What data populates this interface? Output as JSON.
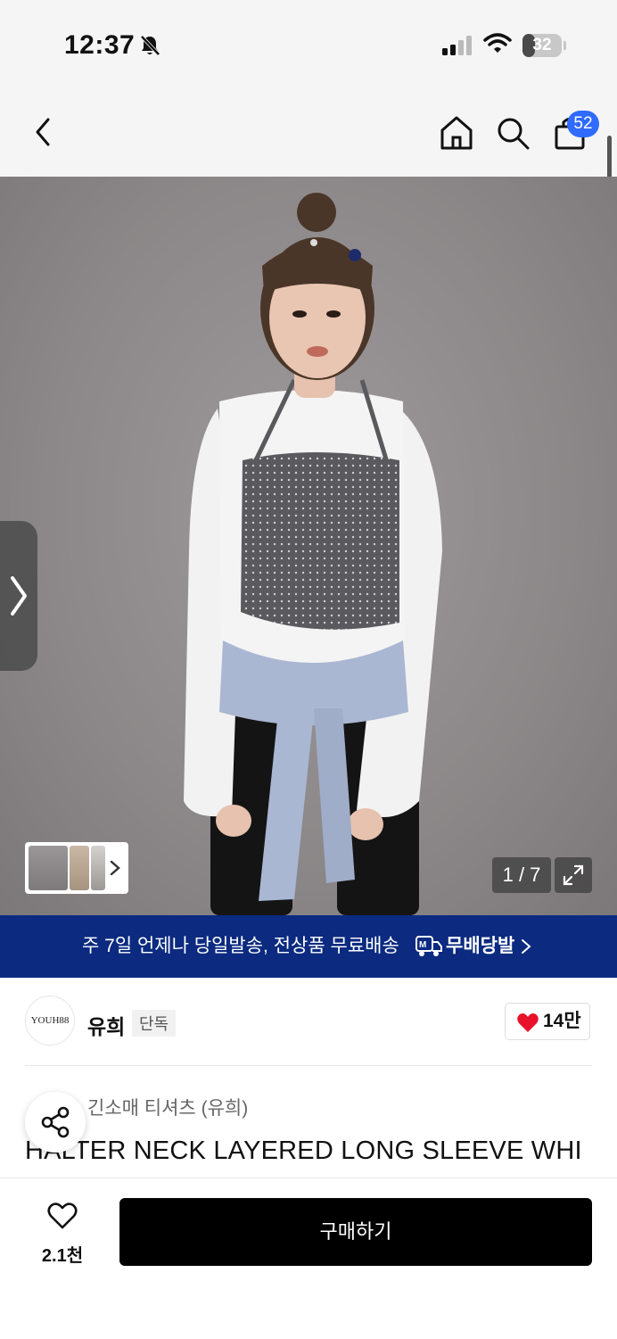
{
  "status_bar": {
    "time": "12:37",
    "battery": "32",
    "battery_level": 0.32
  },
  "nav": {
    "cart_count": "52",
    "icons": [
      "back-icon",
      "home-icon",
      "search-icon",
      "shopping-bag-icon"
    ]
  },
  "gallery": {
    "counter": "1 / 7",
    "colors": {
      "backdrop": "#8c8889"
    }
  },
  "banner": {
    "text": "주 7일 언제나 당일발송, 전상품 무료배송",
    "brand": "무배당발",
    "color": "#0b2a80"
  },
  "brand": {
    "logo_text": "YOUH88",
    "name": "유희",
    "badge": "단독",
    "likes": "14만"
  },
  "product": {
    "category": "긴소매 티셔츠 (유희)",
    "title": "HALTER NECK LAYERED LONG SLEEVE WHI"
  },
  "bottom_bar": {
    "wish_count": "2.1천",
    "buy_label": "구매하기"
  }
}
